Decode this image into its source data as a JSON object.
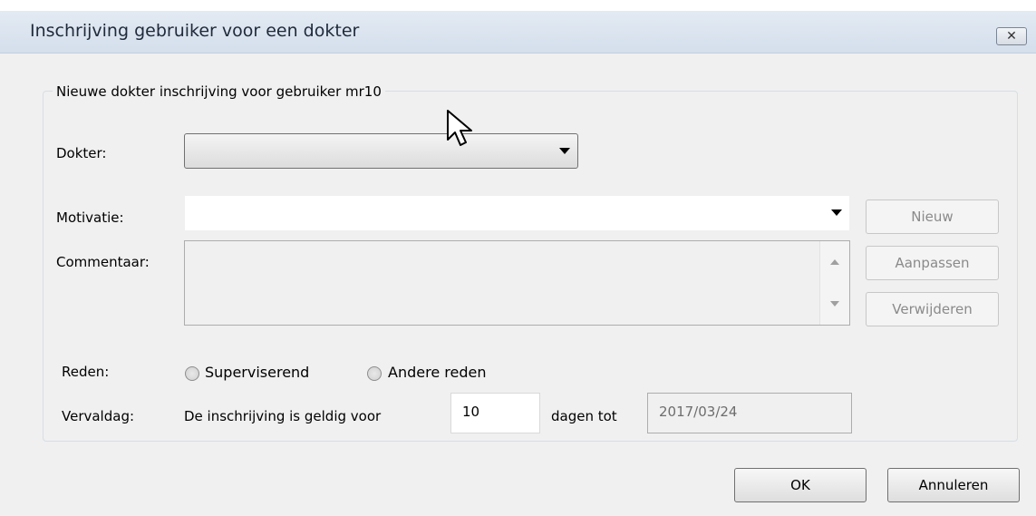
{
  "window": {
    "title": "Inschrijving gebruiker voor een dokter"
  },
  "group": {
    "title": "Nieuwe dokter inschrijving voor gebruiker mr10"
  },
  "form": {
    "dokter_label": "Dokter:",
    "dokter_value": "",
    "motivatie_label": "Motivatie:",
    "motivatie_value": "",
    "commentaar_label": "Commentaar:",
    "commentaar_value": "",
    "reden_label": "Reden:",
    "reden_options": [
      "Superviserend",
      "Andere reden"
    ],
    "vervaldag_label": "Vervaldag:",
    "vervaldag_prefix": "De inschrijving is geldig voor",
    "vervaldag_days": "10",
    "vervaldag_suffix": "dagen tot",
    "vervaldag_date": "2017/03/24"
  },
  "side_buttons": {
    "new": "Nieuw",
    "edit": "Aanpassen",
    "delete": "Verwijderen"
  },
  "footer": {
    "ok": "OK",
    "cancel": "Annuleren"
  },
  "icons": {
    "close": "close-icon",
    "cursor": "mouse-pointer-icon"
  }
}
